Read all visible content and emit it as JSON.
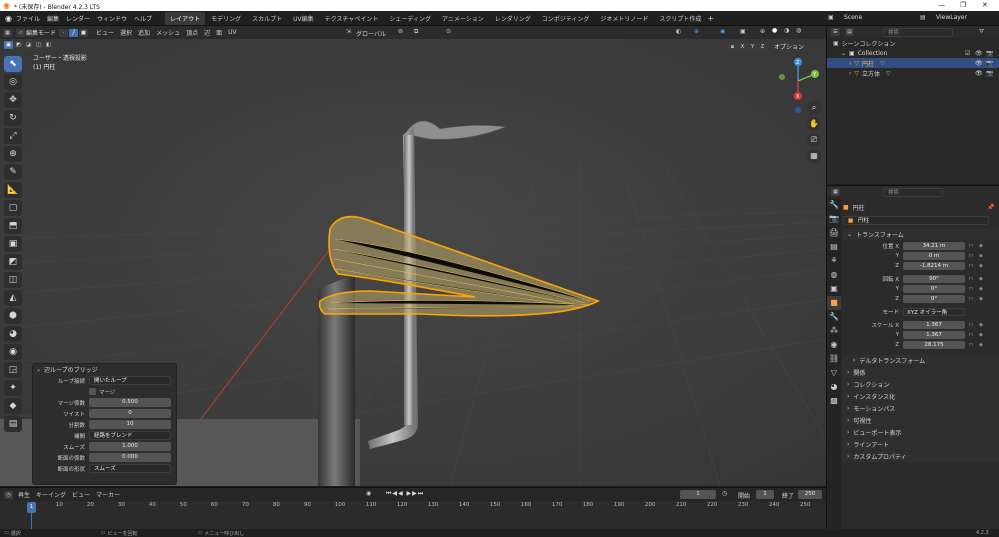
{
  "window": {
    "title": "* (未保存) - Blender 4.2.3 LTS"
  },
  "menu": {
    "items": [
      "ファイル",
      "編集",
      "レンダー",
      "ウィンドウ",
      "ヘルプ"
    ],
    "workspaces": [
      "レイアウト",
      "モデリング",
      "スカルプト",
      "UV編集",
      "テクスチャペイント",
      "シェーディング",
      "アニメーション",
      "レンダリング",
      "コンポジティング",
      "ジオメトリノード",
      "スクリプト作成"
    ],
    "active_workspace": "レイアウト",
    "scene": "Scene",
    "view_layer": "ViewLayer"
  },
  "viewport_header": {
    "mode": "編集モード",
    "menus": [
      "ビュー",
      "選択",
      "追加",
      "メッシュ",
      "頂点",
      "辺",
      "面",
      "UV"
    ],
    "orientation": "グローバル",
    "options_label": "オプション",
    "axes": [
      "X",
      "Y",
      "Z"
    ]
  },
  "viewport": {
    "view_name": "ユーザー・透視投影",
    "object_label": "(1) 円柱"
  },
  "operator_panel": {
    "title": "辺ループのブリッジ",
    "rows": [
      {
        "label": "ループ接続",
        "value": "開いたループ",
        "type": "dropdown"
      },
      {
        "label": "",
        "value": "マージ",
        "type": "checkbox"
      },
      {
        "label": "マージ係数",
        "value": "0.500",
        "type": "number"
      },
      {
        "label": "ツイスト",
        "value": "0",
        "type": "number"
      },
      {
        "label": "分割数",
        "value": "10",
        "type": "number"
      },
      {
        "label": "補間",
        "value": "経路をブレンド",
        "type": "dropdown"
      },
      {
        "label": "スムーズ",
        "value": "1.000",
        "type": "number"
      },
      {
        "label": "断面の係数",
        "value": "0.000",
        "type": "number"
      },
      {
        "label": "断面の形状",
        "value": "スムーズ",
        "type": "dropdown"
      }
    ]
  },
  "timeline": {
    "menus": [
      "再生",
      "キーイング",
      "ビュー",
      "マーカー"
    ],
    "current_frame": "1",
    "start_label": "開始",
    "start": "1",
    "end_label": "終了",
    "end": "250",
    "ticks": [
      "1",
      "10",
      "20",
      "30",
      "40",
      "50",
      "60",
      "70",
      "80",
      "90",
      "100",
      "110",
      "120",
      "130",
      "140",
      "150",
      "160",
      "170",
      "180",
      "190",
      "200",
      "210",
      "220",
      "230",
      "240",
      "250"
    ]
  },
  "statusbar": {
    "items": [
      "選択",
      "ビューを回転",
      "メニュー呼び出し"
    ],
    "version": "4.2.3"
  },
  "outliner": {
    "search_placeholder": "検索",
    "root": "シーンコレクション",
    "collection": "Collection",
    "objects": [
      {
        "name": "円柱",
        "selected": true
      },
      {
        "name": "立方体",
        "selected": false
      }
    ]
  },
  "properties": {
    "search_placeholder": "検索",
    "object_name": "円柱",
    "datablock_name": "円柱",
    "transform_section": "トランスフォーム",
    "location_label": "位置 X",
    "location": [
      "34.21 m",
      "0 m",
      "-1.8214 m"
    ],
    "rotation_label": "回転 X",
    "rotation": [
      "90°",
      "0°",
      "0°"
    ],
    "mode_label": "モード",
    "rotation_mode": "XYZ オイラー角",
    "scale_label": "スケール X",
    "scale": [
      "1.367",
      "1.367",
      "28.175"
    ],
    "y_label": "Y",
    "z_label": "Z",
    "sections": [
      "デルタトランスフォーム",
      "関係",
      "コレクション",
      "インスタンス化",
      "モーションパス",
      "可視性",
      "ビューポート表示",
      "ラインアート",
      "カスタムプロパティ"
    ]
  },
  "colors": {
    "accent": "#4772b3",
    "selection": "#ffa500",
    "x_axis": "#d63a3a",
    "y_axis": "#7bc043",
    "z_axis": "#3f8fe0"
  }
}
